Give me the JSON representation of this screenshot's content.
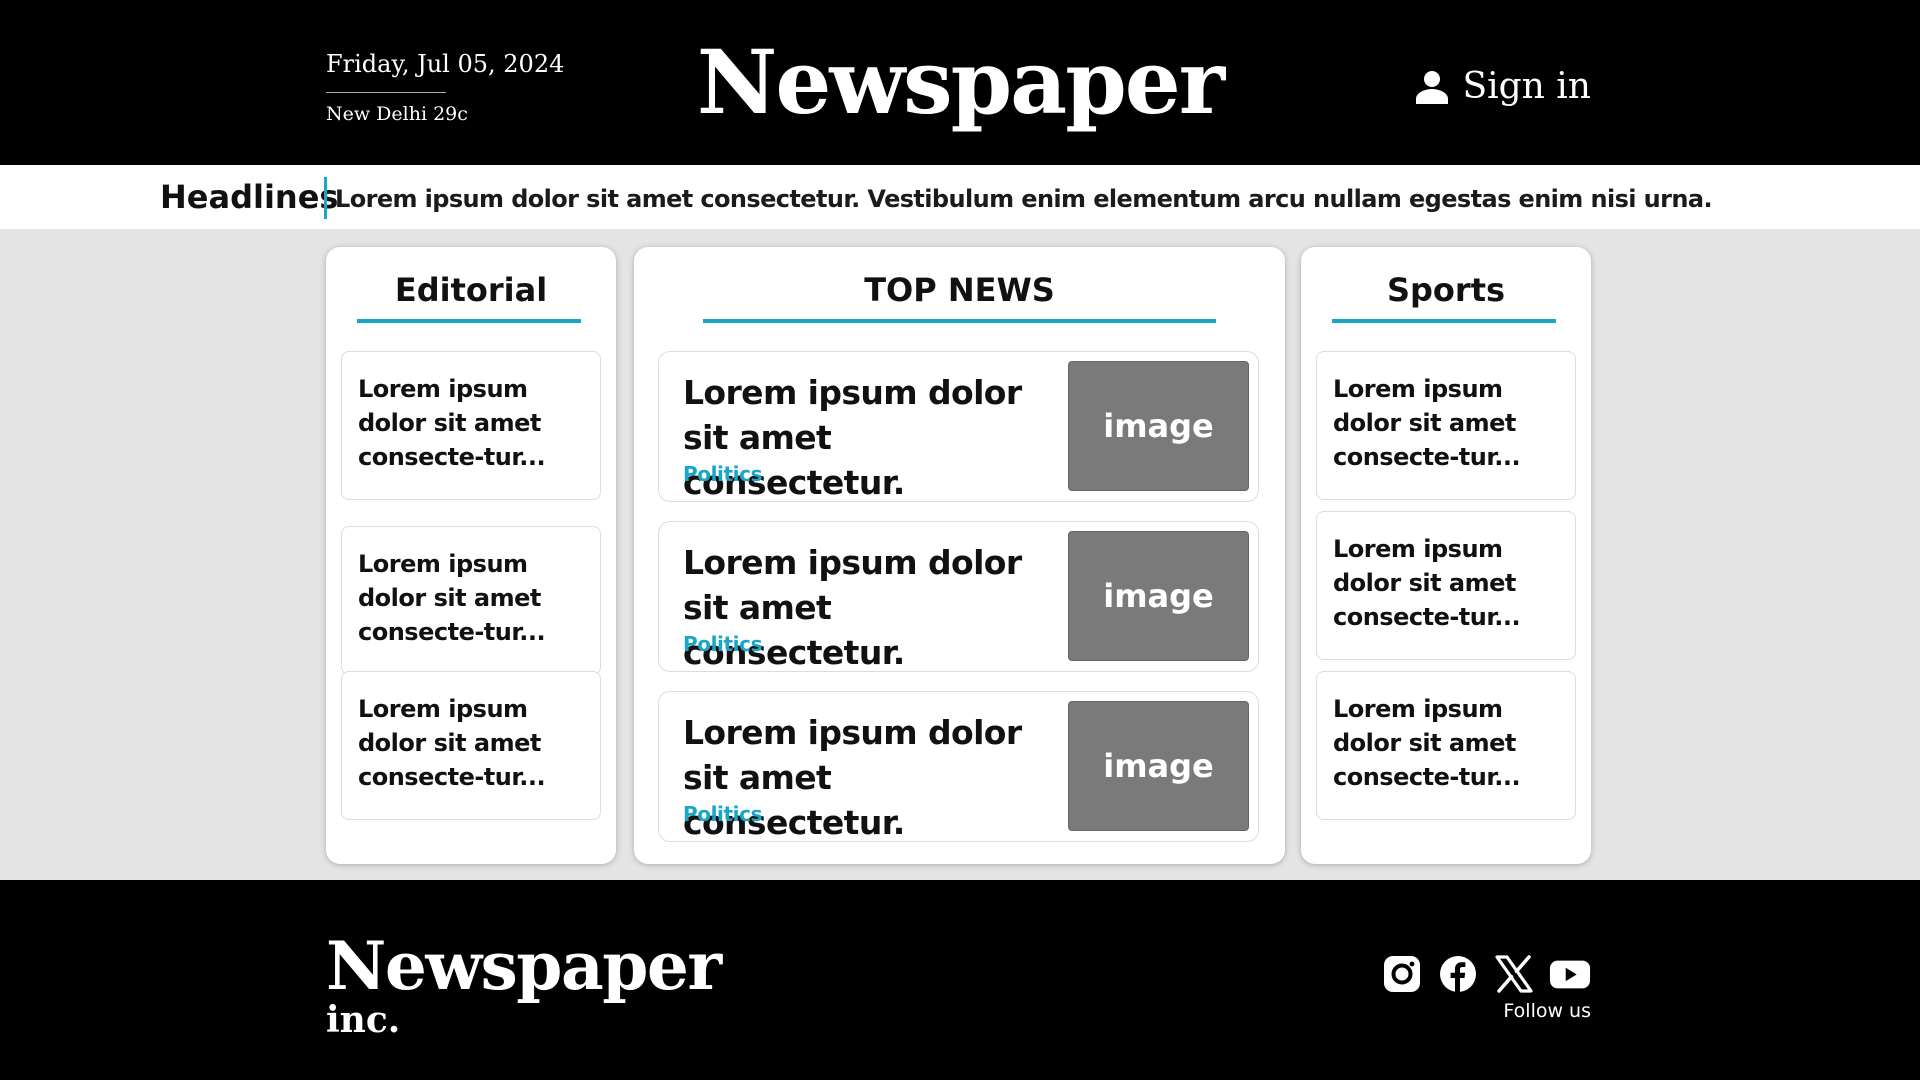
{
  "header": {
    "date": "Friday, Jul 05, 2024",
    "weather": "New Delhi 29c",
    "brand": "Newspaper",
    "signin_label": "Sign in",
    "signin_icon": "user-icon"
  },
  "headlines": {
    "label": "Headlines",
    "text": "Lorem ipsum dolor sit amet consectetur. Vestibulum enim elementum arcu nullam egestas enim nisi urna."
  },
  "editorial": {
    "title": "Editorial",
    "items": [
      "Lorem ipsum dolor sit amet consecte-tur...",
      "Lorem ipsum dolor sit amet consecte-tur...",
      "Lorem ipsum dolor sit amet consecte-tur..."
    ]
  },
  "top_news": {
    "title": "TOP NEWS",
    "items": [
      {
        "title": "Lorem ipsum dolor sit amet consectetur.",
        "tag": "Politics",
        "image_label": "image"
      },
      {
        "title": "Lorem ipsum dolor sit amet consectetur.",
        "tag": "Politics",
        "image_label": "image"
      },
      {
        "title": "Lorem ipsum dolor sit amet consectetur.",
        "tag": "Politics",
        "image_label": "image"
      }
    ]
  },
  "sports": {
    "title": "Sports",
    "items": [
      "Lorem ipsum dolor sit amet consecte-tur...",
      "Lorem ipsum dolor sit amet consecte-tur...",
      "Lorem ipsum dolor sit amet consecte-tur..."
    ]
  },
  "footer": {
    "brand": "Newspaper",
    "suffix": "inc.",
    "follow_label": "Follow us",
    "socials": [
      "instagram-icon",
      "facebook-icon",
      "x-icon",
      "youtube-icon"
    ]
  },
  "colors": {
    "accent": "#1aa7c7",
    "header_bg": "#000000",
    "page_bg": "#e4e4e4",
    "image_placeholder": "#7a7a7a"
  }
}
